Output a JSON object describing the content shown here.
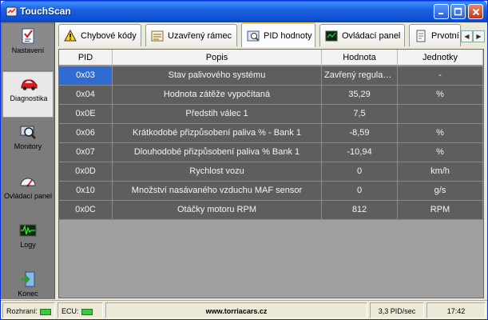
{
  "window": {
    "title": "TouchScan"
  },
  "sidebar": {
    "items": [
      {
        "label": "Nastavení",
        "icon": "checklist-icon"
      },
      {
        "label": "Diagnostika",
        "icon": "car-icon"
      },
      {
        "label": "Monitory",
        "icon": "magnifier-icon"
      },
      {
        "label": "Ovládací panel",
        "icon": "gauge-icon"
      },
      {
        "label": "Logy",
        "icon": "waveform-icon"
      },
      {
        "label": "Konec",
        "icon": "exit-door-icon"
      }
    ],
    "active_index": 1
  },
  "tabs": [
    {
      "label": "Chybové kódy",
      "icon": "warning-icon"
    },
    {
      "label": "Uzavřený rámec",
      "icon": "frame-icon"
    },
    {
      "label": "PID hodnoty",
      "icon": "pid-icon"
    },
    {
      "label": "Ovládací panel",
      "icon": "panel-icon"
    },
    {
      "label": "Prvotní",
      "icon": "document-icon"
    }
  ],
  "active_tab": 2,
  "table": {
    "headers": [
      "PID",
      "Popis",
      "Hodnota",
      "Jednotky"
    ],
    "rows": [
      {
        "pid": "0x03",
        "desc": "Stav palivového systému",
        "value": "Zavřený regulač...",
        "unit": "-"
      },
      {
        "pid": "0x04",
        "desc": "Hodnota zátěže vypočítaná",
        "value": "35,29",
        "unit": "%"
      },
      {
        "pid": "0x0E",
        "desc": "Předstih válec 1",
        "value": "7,5",
        "unit": ""
      },
      {
        "pid": "0x06",
        "desc": "Krátkodobé přizpůsobení paliva % - Bank 1",
        "value": "-8,59",
        "unit": "%"
      },
      {
        "pid": "0x07",
        "desc": "Dlouhodobé přizpůsobení paliva % Bank 1",
        "value": "-10,94",
        "unit": "%"
      },
      {
        "pid": "0x0D",
        "desc": "Rychlost vozu",
        "value": "0",
        "unit": "km/h"
      },
      {
        "pid": "0x10",
        "desc": "Množství nasávaného vzduchu MAF sensor",
        "value": "0",
        "unit": "g/s"
      },
      {
        "pid": "0x0C",
        "desc": "Otáčky motoru RPM",
        "value": "812",
        "unit": "RPM"
      }
    ],
    "selected_row": 0
  },
  "statusbar": {
    "interface_label": "Rozhraní:",
    "ecu_label": "ECU:",
    "website": "www.torriacars.cz",
    "rate": "3,3 PID/sec",
    "time": "17:42"
  },
  "colors": {
    "titlebar": "#0b4fd0",
    "row_bg": "#5e5e5e",
    "selected": "#2f6bd0",
    "led": "#3fc83f"
  }
}
